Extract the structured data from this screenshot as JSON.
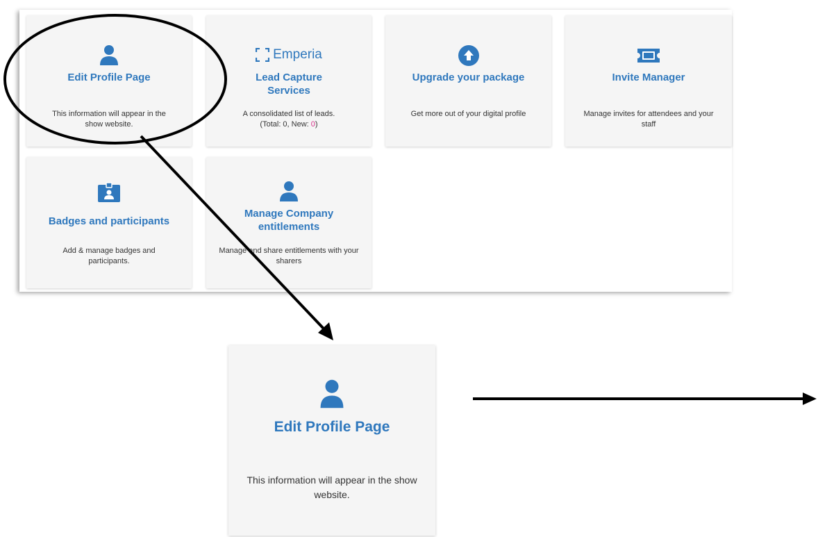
{
  "cards": [
    {
      "title": "Edit Profile Page",
      "desc": "This information will appear in the show website."
    },
    {
      "brand": "Emperia",
      "title": "Lead Capture Services",
      "desc_prefix": "A consolidated list of leads.",
      "desc_counts": "(Total: 0, New: ",
      "desc_new": "0",
      "desc_end": ")"
    },
    {
      "title": "Upgrade your package",
      "desc": "Get more out of your digital profile"
    },
    {
      "title": "Invite Manager",
      "desc": "Manage invites for attendees and your staff"
    },
    {
      "title": "Badges and participants",
      "desc": "Add & manage badges and participants."
    },
    {
      "title": "Manage Company entitlements",
      "desc": "Manage and share entitlements with your sharers"
    }
  ],
  "zoom_card": {
    "title": "Edit Profile Page",
    "desc": "This information will appear in the show website."
  },
  "colors": {
    "accent": "#2f78bd",
    "card_bg": "#f5f5f5",
    "new_count": "#d6338a"
  },
  "icons": [
    "user-icon",
    "emperia-logo-icon",
    "upload-circle-icon",
    "ticket-icon",
    "id-badge-icon",
    "user-icon"
  ]
}
